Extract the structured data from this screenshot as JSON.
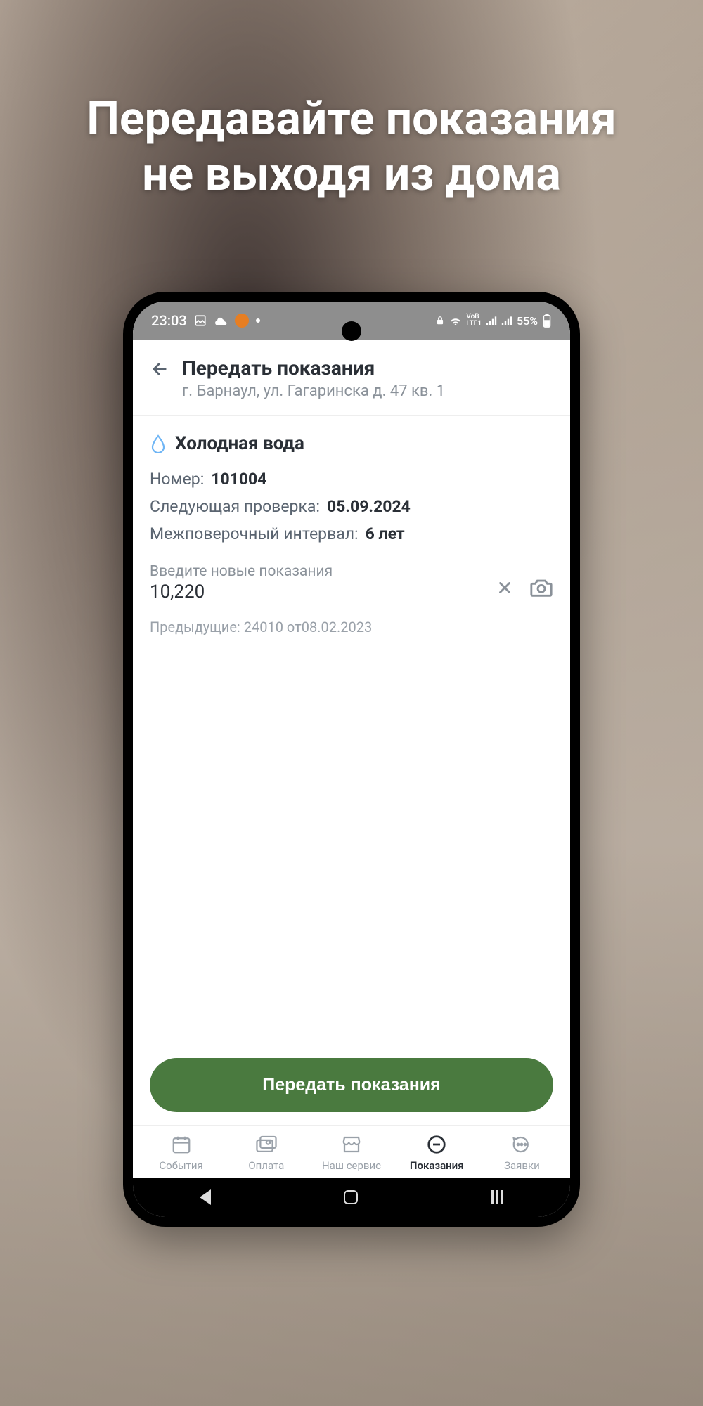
{
  "promo": {
    "title_line1": "Передавайте показания",
    "title_line2": "не выходя из дома"
  },
  "status_bar": {
    "time": "23:03",
    "battery": "55%",
    "network": "LTE1"
  },
  "header": {
    "title": "Передать показания",
    "subtitle": "г. Барнаул, ул. Гагаринска д. 47 кв. 1"
  },
  "meter": {
    "section_title": "Холодная вода",
    "number_label": "Номер:",
    "number_value": "101004",
    "next_check_label": "Следующая проверка:",
    "next_check_value": "05.09.2024",
    "interval_label": "Межповерочный интервал:",
    "interval_value": "6 лет",
    "input_label": "Введите новые показания",
    "input_value": "10,220",
    "previous_reading": "Предыдущие: 24010 от08.02.2023"
  },
  "submit_label": "Передать показания",
  "nav": {
    "items": [
      {
        "label": "События"
      },
      {
        "label": "Оплата"
      },
      {
        "label": "Наш сервис"
      },
      {
        "label": "Показания"
      },
      {
        "label": "Заявки"
      }
    ]
  }
}
